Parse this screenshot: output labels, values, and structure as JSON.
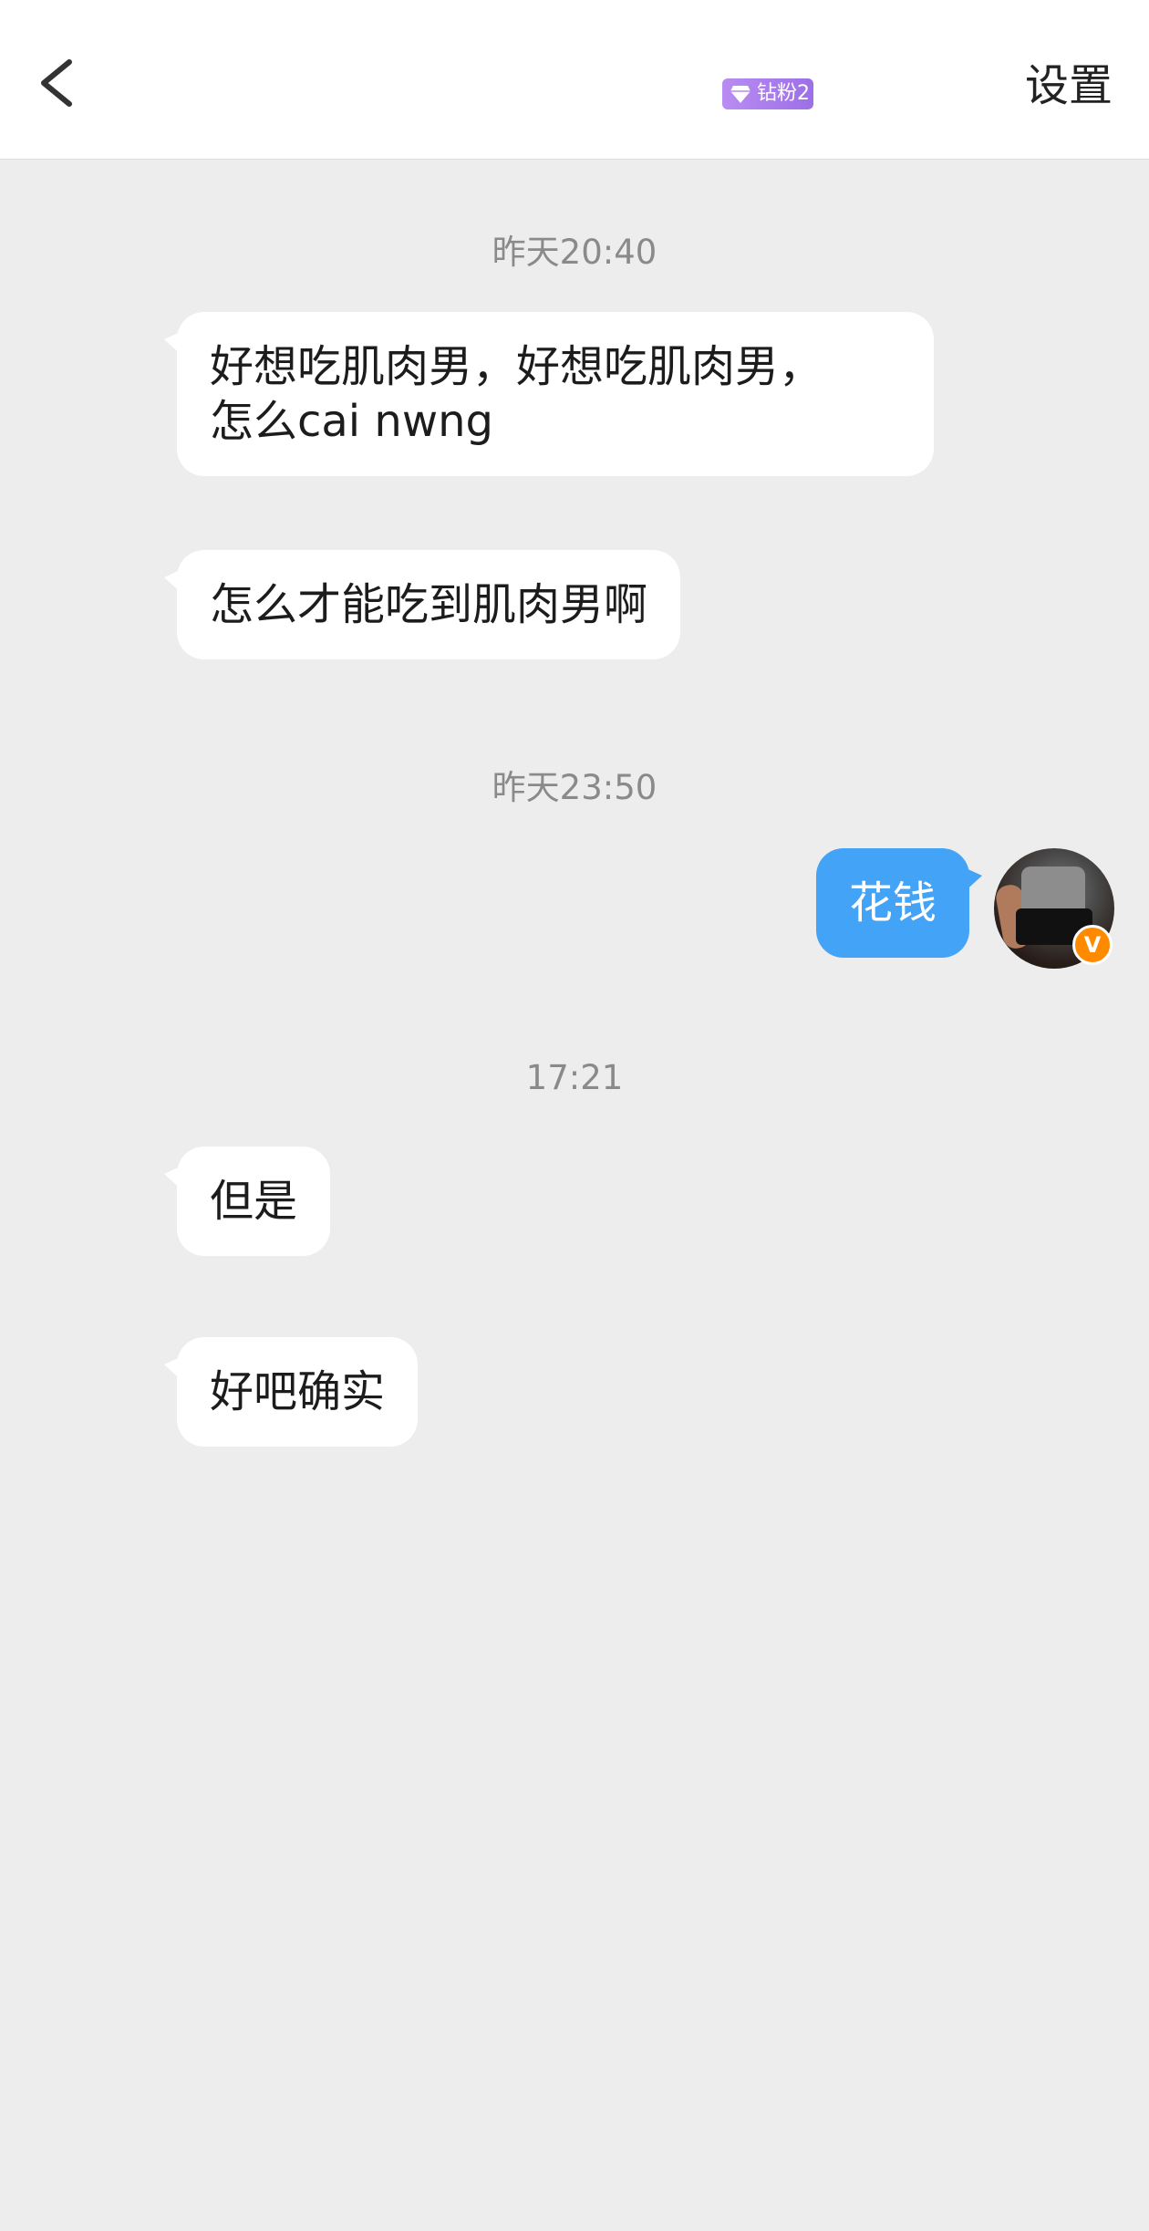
{
  "header": {
    "back_icon": "chevron-left-icon",
    "badge_label": "钻粉2",
    "badge_icon": "diamond-icon",
    "settings_label": "设置"
  },
  "messages": [
    {
      "type": "time",
      "text": "昨天20:40"
    },
    {
      "type": "received",
      "text": "好想吃肌肉男，好想吃肌肉男，\n怎么cai nwng"
    },
    {
      "type": "received",
      "text": "怎么才能吃到肌肉男啊"
    },
    {
      "type": "time",
      "text": "昨天23:50"
    },
    {
      "type": "sent",
      "text": "花钱"
    },
    {
      "type": "time",
      "text": "17:21"
    },
    {
      "type": "received",
      "text": "但是"
    },
    {
      "type": "received",
      "text": "好吧确实"
    }
  ],
  "avatar": {
    "verified_label": "V",
    "colors": {
      "badge": "#ff8a00"
    }
  },
  "colors": {
    "background": "#ededed",
    "sent_bubble": "#43a3f6",
    "received_bubble": "#ffffff",
    "badge": "#a77bef"
  }
}
